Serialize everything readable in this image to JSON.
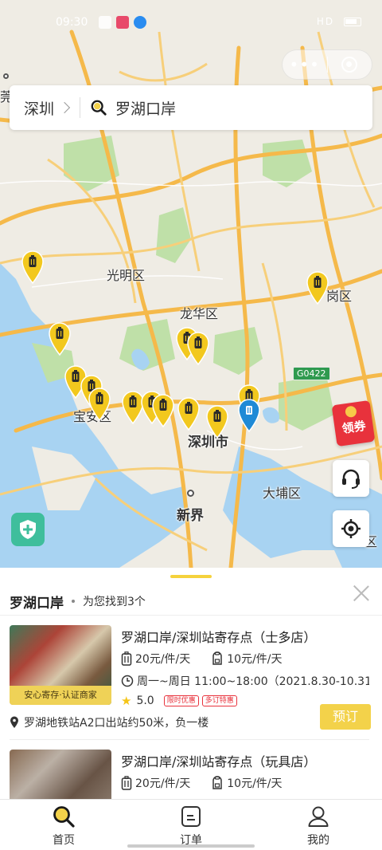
{
  "statusbar": {
    "time": "09:30",
    "network": "HD"
  },
  "search": {
    "city": "深圳",
    "query": "罗湖口岸"
  },
  "map": {
    "labels": {
      "guangming": "光明区",
      "longhua": "龙华区",
      "baoan": "宝安区",
      "shenzhen": "深圳市",
      "xinjie": "新界",
      "dapeng": "大埔区",
      "longgang": "岗区",
      "left_edge": "莞",
      "right_edge": "区"
    },
    "road_badge": "G0422",
    "red_packet": "领券"
  },
  "results": {
    "title": "罗湖口岸",
    "count_text": "为您找到3个",
    "stores": [
      {
        "name": "罗湖口岸/深圳站寄存点（士多店）",
        "price_large": "20元/件/天",
        "price_small": "10元/件/天",
        "hours": "周一~周日 11:00~18:00（2021.8.30-10.31…",
        "rating": "5.0",
        "tags": [
          "限时优惠",
          "多订特惠"
        ],
        "badge": "安心寄存·认证商家",
        "location": "罗湖地铁站A2口出站约50米，负一楼",
        "book_label": "预订"
      },
      {
        "name": "罗湖口岸/深圳站寄存点（玩具店）",
        "price_large": "20元/件/天",
        "price_small": "10元/件/天"
      }
    ]
  },
  "tabbar": {
    "home": "首页",
    "orders": "订单",
    "mine": "我的"
  },
  "colors": {
    "accent": "#f3d24a",
    "pin": "#f2c81e",
    "current_pin": "#1f8ad6"
  }
}
